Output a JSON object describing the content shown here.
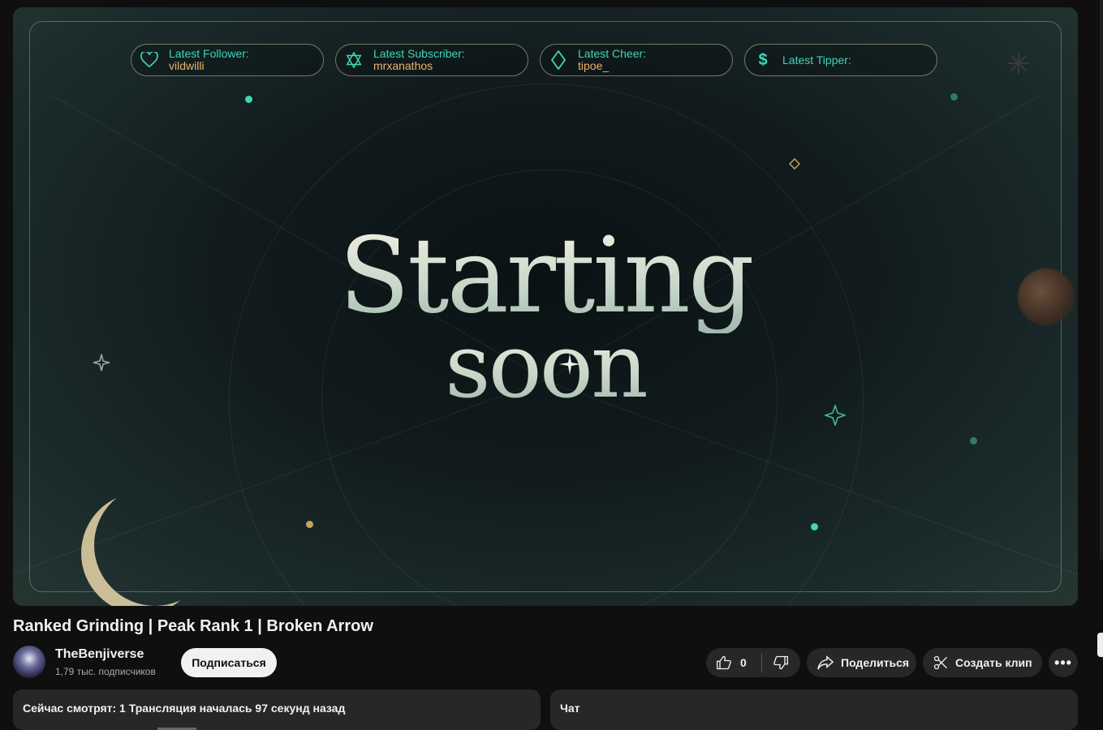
{
  "stream": {
    "widgets": [
      {
        "label": "Latest Follower:",
        "value": "vildwilli",
        "icon": "heart-icon"
      },
      {
        "label": "Latest Subscriber:",
        "value": "mrxanathos",
        "icon": "star-of-david-icon"
      },
      {
        "label": "Latest Cheer:",
        "value": "tipoe_",
        "icon": "diamond-icon"
      },
      {
        "label": "Latest Tipper:",
        "value": "",
        "icon": "dollar-icon"
      }
    ],
    "headline_line1": "Starting",
    "headline_line2": "soon",
    "colors": {
      "accent": "#3fd6b8",
      "value": "#e6b46a",
      "moon": "#cbbd97"
    }
  },
  "video": {
    "title": "Ranked Grinding | Peak Rank 1 | Broken Arrow"
  },
  "channel": {
    "name": "TheBenjiverse",
    "subscribers": "1,79 тыс. подписчиков",
    "subscribe_label": "Подписаться"
  },
  "actions": {
    "like_count": "0",
    "share_label": "Поделиться",
    "clip_label": "Создать клип"
  },
  "panels": {
    "live_status": "Сейчас смотрят: 1  Трансляция началась 97 секунд назад",
    "chat_label": "Чат"
  }
}
